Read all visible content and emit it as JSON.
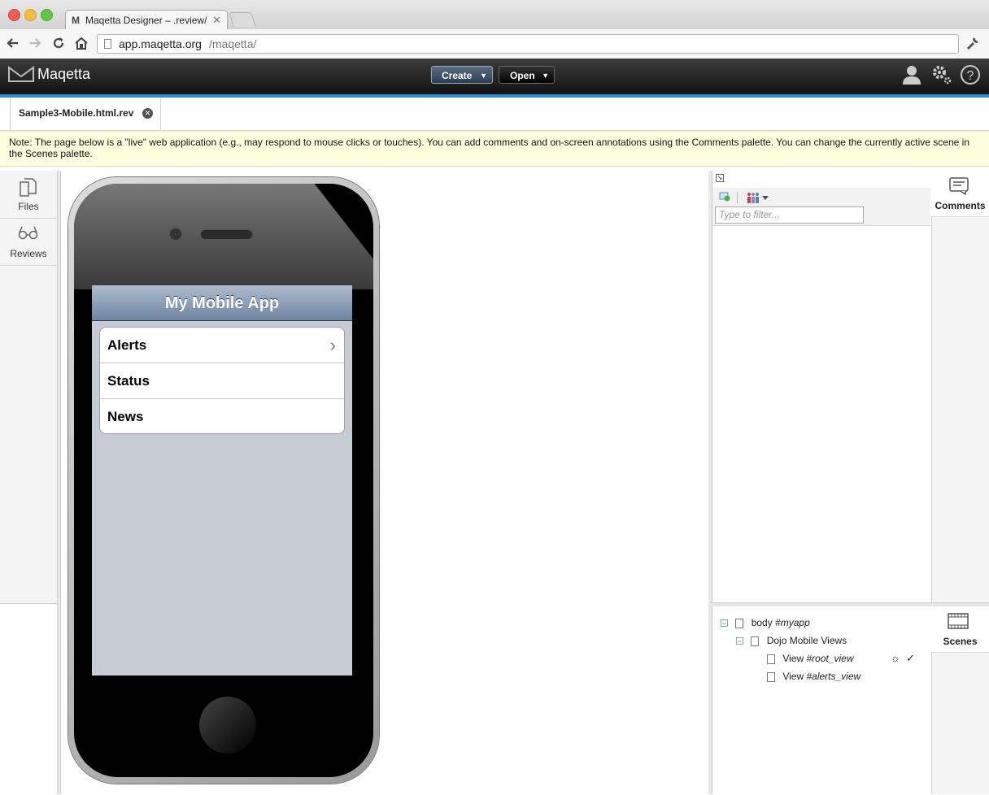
{
  "browser": {
    "tab_title": "Maqetta Designer – .review/",
    "url_host": "app.maqetta.org",
    "url_path": "/maqetta/"
  },
  "app": {
    "logo_text": "Maqetta",
    "create_label": "Create",
    "open_label": "Open"
  },
  "editor": {
    "tab_label": "Sample3-Mobile.html.rev",
    "note": "Note: The page below is a \"live\" web application (e.g., may respond to mouse clicks or touches). You can add comments and on-screen annotations using the Comments palette. You can change the currently active scene in the Scenes palette."
  },
  "left_sidebar": {
    "files_label": "Files",
    "reviews_label": "Reviews"
  },
  "mobile": {
    "title": "My Mobile App",
    "items": [
      {
        "label": "Alerts",
        "arrow": "›"
      },
      {
        "label": "Status",
        "arrow": ""
      },
      {
        "label": "News",
        "arrow": ""
      }
    ]
  },
  "comments": {
    "filter_placeholder": "Type to filter...",
    "tab_label": "Comments"
  },
  "scenes": {
    "tab_label": "Scenes",
    "tree": {
      "body_prefix": "body ",
      "body_id": "#myapp",
      "views_label": "Dojo Mobile Views",
      "view_prefix": "View ",
      "root_view_id": "#root_view",
      "alerts_view_id": "#alerts_view",
      "initial_mark": "☼",
      "current_mark": "✓"
    }
  },
  "icons": {
    "back": "arrow-left-icon",
    "forward": "arrow-right-icon",
    "reload": "reload-icon",
    "home": "home-icon",
    "wrench": "wrench-icon",
    "user": "user-icon",
    "gear": "gear-icon",
    "help": "help-icon"
  },
  "colors": {
    "accent_bar": "#2b8ccf",
    "note_bg": "#ffffe0",
    "mobile_nav": "#6d84a2"
  }
}
